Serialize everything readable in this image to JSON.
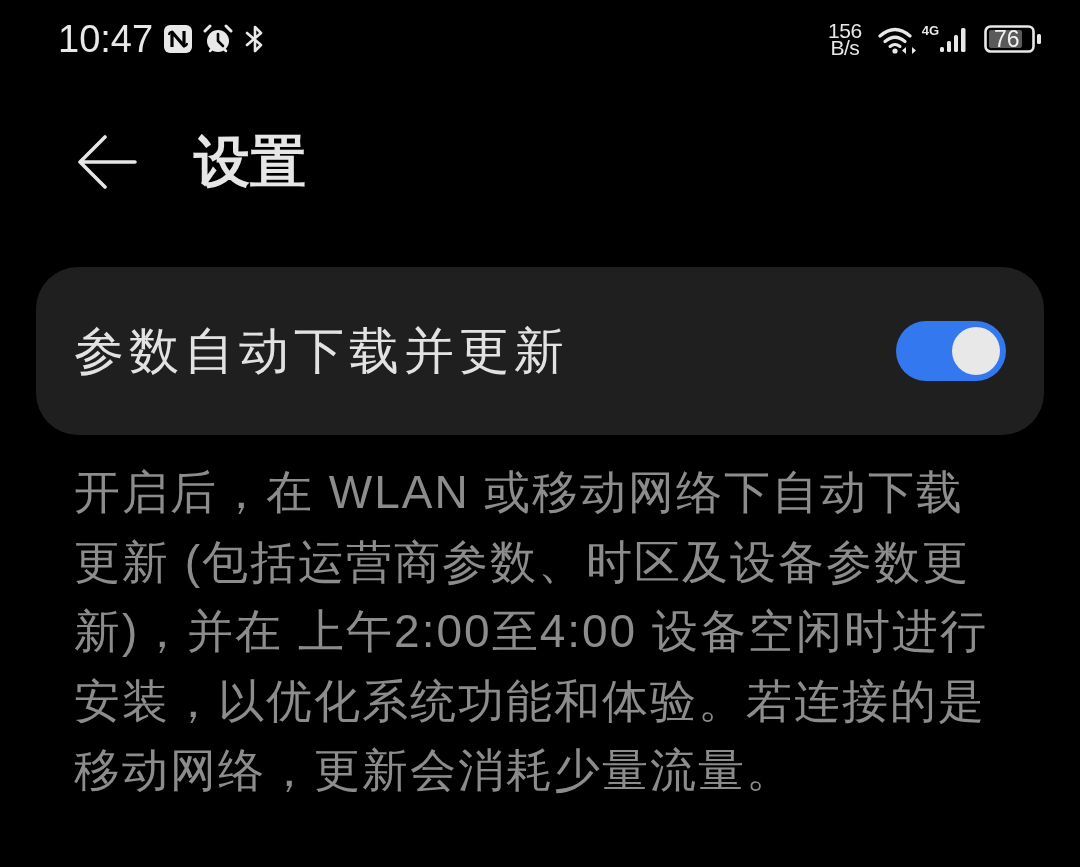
{
  "status_bar": {
    "time": "10:47",
    "network_speed": {
      "value": "156",
      "unit": "B/s"
    },
    "network_type": "4G",
    "battery": "76"
  },
  "header": {
    "title": "设置"
  },
  "setting": {
    "label": "参数自动下载并更新",
    "on": true
  },
  "description": "开启后，在 WLAN 或移动网络下自动下载更新 (包括运营商参数、时区及设备参数更新)，并在 上午2:00至4:00 设备空闲时进行安装，以优化系统功能和体验。若连接的是移动网络，更新会消耗少量流量。"
}
